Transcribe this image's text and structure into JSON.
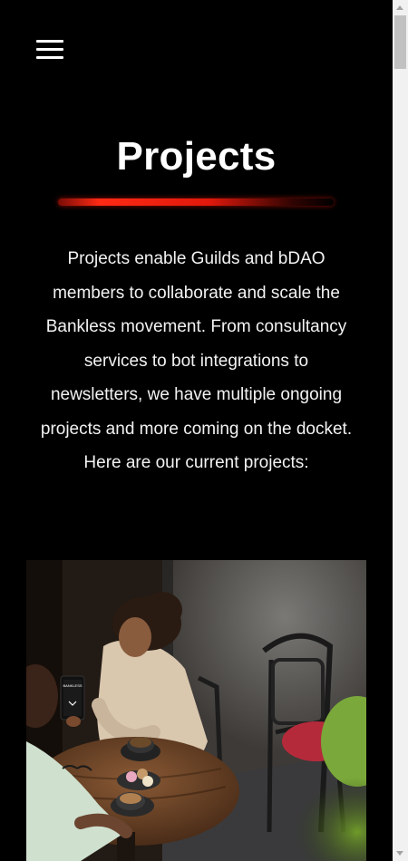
{
  "header": {
    "menu_icon": "hamburger-menu-icon"
  },
  "main": {
    "title": "Projects",
    "accent_color": "#ff2a14",
    "intro": "Projects enable Guilds and bDAO members to collaborate and scale the Bankless movement. From consultancy services to bot integrations to newsletters, we have multiple ongoing projects and more coming on the docket. Here are our current projects:"
  },
  "photo": {
    "phone_screen_text": "BANKLESS"
  },
  "colors": {
    "background": "#000000",
    "text": "#ffffff"
  }
}
